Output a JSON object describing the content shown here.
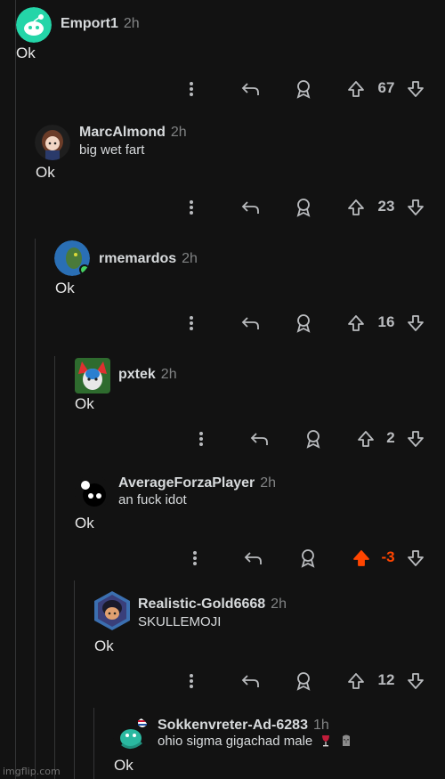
{
  "comments": [
    {
      "user": "Emport1",
      "time": "2h",
      "flair": "",
      "body": "Ok",
      "score": "67",
      "vote": "none"
    },
    {
      "user": "MarcAlmond",
      "time": "2h",
      "flair": "big wet fart",
      "body": "Ok",
      "score": "23",
      "vote": "none"
    },
    {
      "user": "rmemardos",
      "time": "2h",
      "flair": "",
      "body": "Ok",
      "score": "16",
      "vote": "none"
    },
    {
      "user": "pxtek",
      "time": "2h",
      "flair": "",
      "body": "Ok",
      "score": "2",
      "vote": "none"
    },
    {
      "user": "AverageForzaPlayer",
      "time": "2h",
      "flair": "an fuck idot",
      "body": "Ok",
      "score": "-3",
      "vote": "up"
    },
    {
      "user": "Realistic-Gold6668",
      "time": "2h",
      "flair": "SKULLEMOJI",
      "body": "Ok",
      "score": "12",
      "vote": "none"
    },
    {
      "user": "Sokkenvreter-Ad-6283",
      "time": "1h",
      "flair": "ohio sigma gigachad male",
      "body": "Ok",
      "score": "",
      "vote": "none"
    }
  ],
  "colors": {
    "background": "#121212",
    "upvote_active": "#ff4500",
    "thread_line": "#343536"
  },
  "icons": [
    "more-options-icon",
    "reply-icon",
    "award-icon",
    "upvote-icon",
    "downvote-icon",
    "wine-glass-emoji",
    "moai-emoji"
  ],
  "watermark": "imgflip.com"
}
